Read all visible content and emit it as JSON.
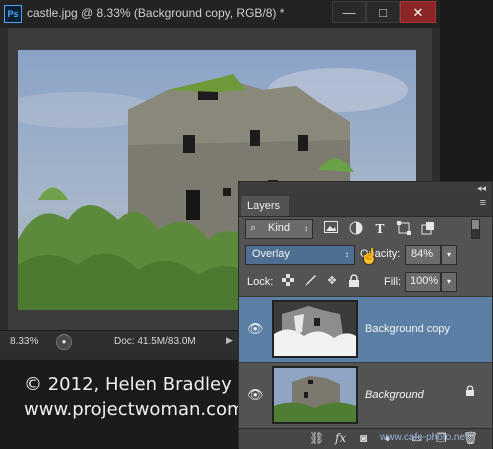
{
  "window": {
    "app_icon": "Ps",
    "title": "castle.jpg @ 8.33% (Background copy, RGB/8) *",
    "minimize_icon": "minimize-icon",
    "maximize_icon": "maximize-icon",
    "close_icon": "close-icon",
    "close_glyph": "✕",
    "min_glyph": "—",
    "max_glyph": "□"
  },
  "status": {
    "zoom": "8.33%",
    "doc_size": "Doc: 41.5M/83.0M",
    "arrow": "▶"
  },
  "credits": {
    "line1": "© 2012, Helen Bradley",
    "line2": "www.projectwoman.com"
  },
  "layers_panel": {
    "collapse": "◂◂",
    "tab": "Layers",
    "menu": "≡",
    "filter_kind": "Kind",
    "filter_icons": [
      "image-filter-icon",
      "adjustment-filter-icon",
      "type-filter-icon",
      "shape-filter-icon",
      "smart-object-filter-icon"
    ],
    "blend_mode": "Overlay",
    "opacity_label": "Opacity:",
    "opacity_value": "84%",
    "lock_label": "Lock:",
    "fill_label": "Fill:",
    "fill_value": "100%",
    "layers": [
      {
        "name": "Background copy",
        "selected": true,
        "visible": true
      },
      {
        "name": "Background",
        "selected": false,
        "visible": true,
        "locked": true
      }
    ],
    "footer_icons": [
      "link-icon",
      "fx-icon",
      "mask-icon",
      "adjustment-icon",
      "folder-icon",
      "new-layer-icon",
      "trash-icon"
    ],
    "fx_text": "fx",
    "dropdown_glyph": "▾",
    "updown_glyph": "↕"
  },
  "watermark": "www.cafe-photo.net",
  "colors": {
    "accent_selection": "#5c7fa6",
    "close_button": "#8a2626"
  }
}
